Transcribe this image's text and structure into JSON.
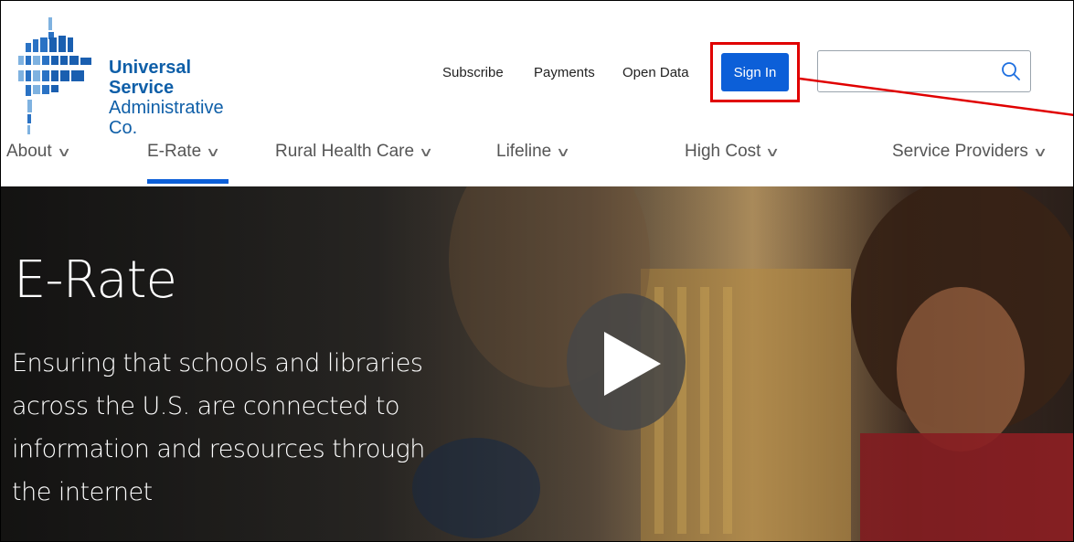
{
  "header": {
    "logo": {
      "line1": "Universal Service",
      "line2": "Administrative Co."
    },
    "links": [
      "Subscribe",
      "Payments",
      "Open Data"
    ],
    "sign_in": "Sign In",
    "search": {
      "value": "",
      "placeholder": ""
    }
  },
  "nav": {
    "items": [
      {
        "label": "About"
      },
      {
        "label": "E-Rate"
      },
      {
        "label": "Rural Health Care"
      },
      {
        "label": "Lifeline"
      },
      {
        "label": "High Cost"
      },
      {
        "label": "Service Providers"
      }
    ],
    "active": "E-Rate"
  },
  "hero": {
    "title": "E-Rate",
    "lines": [
      "Ensuring that schools and libraries",
      "across the U.S. are connected to",
      "information and resources through",
      "the internet"
    ]
  },
  "colors": {
    "brand": "#0f5fa8",
    "button": "#0c5fd8",
    "highlight": "#e00000"
  }
}
